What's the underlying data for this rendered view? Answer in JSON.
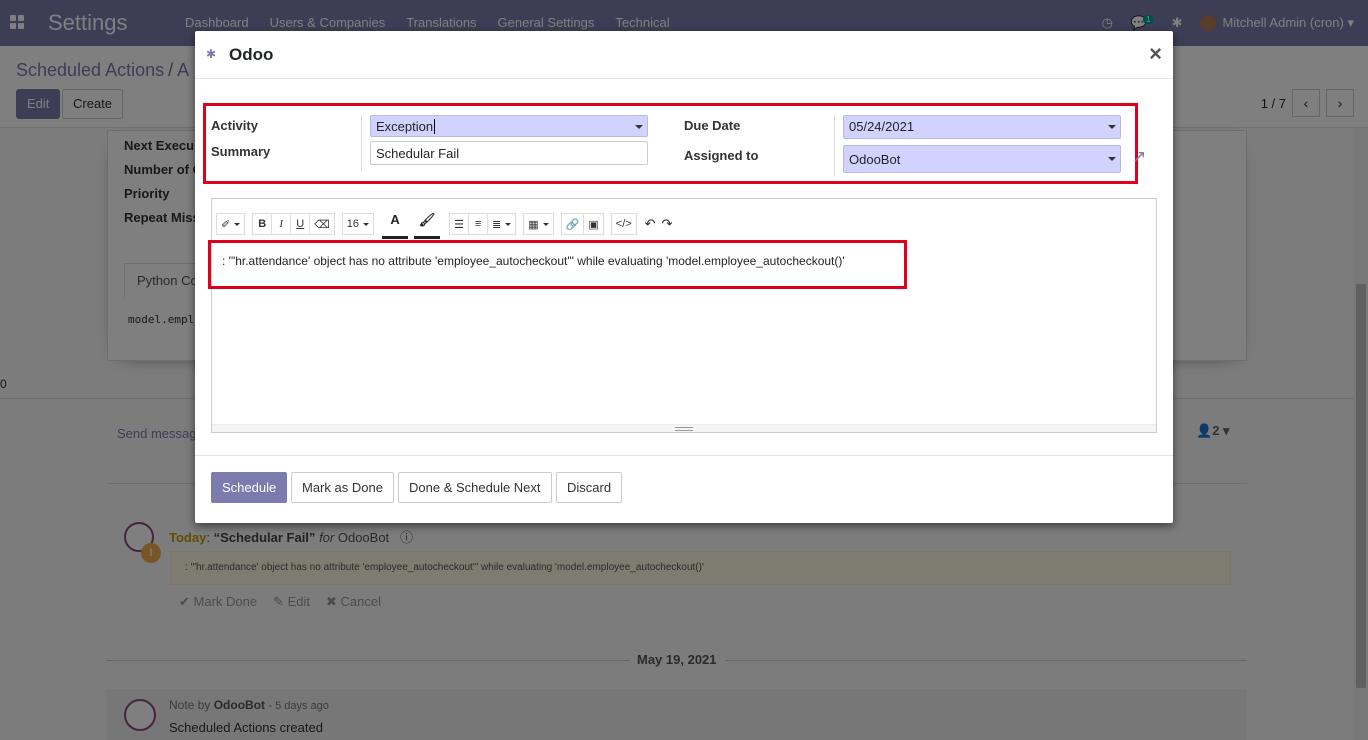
{
  "navbar": {
    "app_title": "Settings",
    "menu": [
      "Dashboard",
      "Users & Companies",
      "Translations",
      "General Settings",
      "Technical"
    ],
    "messages_count": "1",
    "user": "Mitchell Admin (cron)"
  },
  "control_panel": {
    "breadcrumb_root": "Scheduled Actions",
    "breadcrumb_sep": "/",
    "breadcrumb_current": "A",
    "edit_label": "Edit",
    "create_label": "Create",
    "pager": "1 / 7"
  },
  "sheet": {
    "labels": [
      "Next Execu",
      "Number of C",
      "Priority",
      "Repeat Miss"
    ],
    "tab_label": "Python Co",
    "code": "model.employ"
  },
  "stray_zero": "0",
  "chatter": {
    "send_message": "Send messag",
    "followers_count": "2",
    "activity": {
      "today": "Today",
      "summary": "“Schedular Fail”",
      "for_word": "for",
      "assignee": "OdooBot",
      "note": ": '\"hr.attendance' object has no attribute 'employee_autocheckout'\" while evaluating 'model.employee_autocheckout()'",
      "mark_done": "Mark Done",
      "edit": "Edit",
      "cancel": "Cancel"
    },
    "date_separator": "May 19, 2021",
    "note": {
      "prefix": "Note by",
      "author": "OdooBot",
      "ago": "- 5 days ago",
      "body": "Scheduled Actions created"
    }
  },
  "modal": {
    "title": "Odoo",
    "close_symbol": "×",
    "activity_label": "Activity",
    "activity_value": "Exception",
    "summary_label": "Summary",
    "summary_value": "Schedular Fail",
    "due_date_label": "Due Date",
    "due_date_value": "05/24/2021",
    "assigned_label": "Assigned to",
    "assigned_value": "OdooBot",
    "font_size": "16",
    "editor_text": ": '\"hr.attendance' object has no attribute 'employee_autocheckout'\" while evaluating 'model.employee_autocheckout()'",
    "buttons": {
      "schedule": "Schedule",
      "mark_done": "Mark as Done",
      "done_next": "Done & Schedule Next",
      "discard": "Discard"
    }
  },
  "colors": {
    "brand": "#7c7bad",
    "highlight_box": "#e0001b",
    "required_field": "#d2d2ff"
  }
}
